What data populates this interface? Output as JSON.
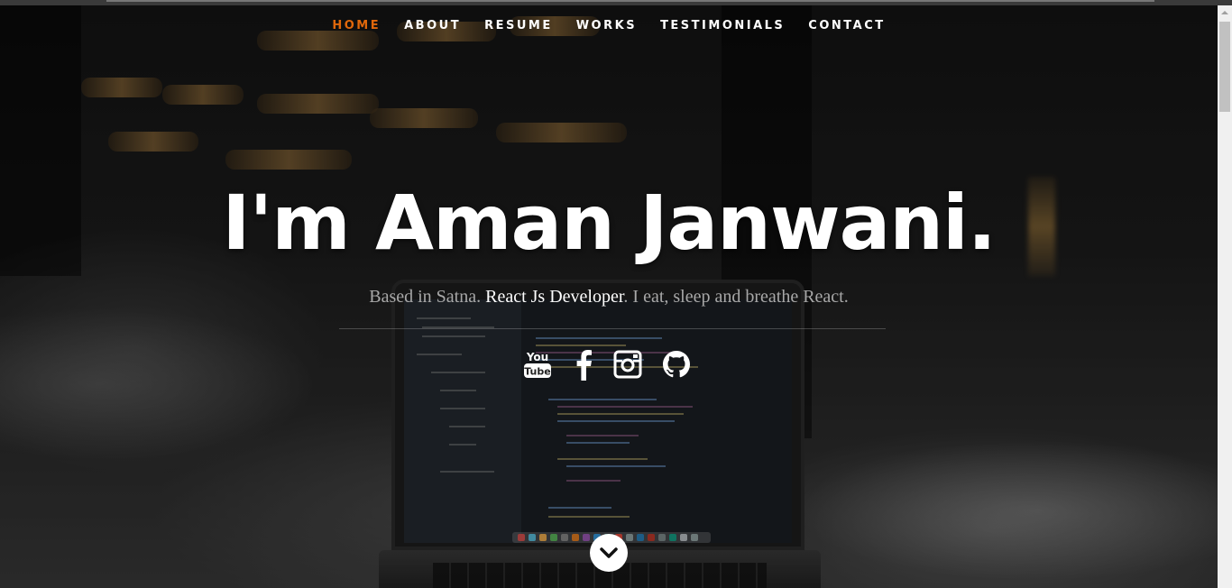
{
  "nav": {
    "items": [
      {
        "label": "HOME",
        "active": true
      },
      {
        "label": "ABOUT",
        "active": false
      },
      {
        "label": "RESUME",
        "active": false
      },
      {
        "label": "WORKS",
        "active": false
      },
      {
        "label": "TESTIMONIALS",
        "active": false
      },
      {
        "label": "CONTACT",
        "active": false
      }
    ],
    "active_color": "#e0670b"
  },
  "hero": {
    "headline": "I'm Aman Janwani.",
    "tagline_prefix": "Based in Satna. ",
    "tagline_strong": "React Js Developer",
    "tagline_suffix": ". I eat, sleep and breathe React."
  },
  "social": [
    {
      "name": "youtube-icon",
      "glyph": "You Tube"
    },
    {
      "name": "facebook-icon",
      "glyph": "f"
    },
    {
      "name": "instagram-icon",
      "glyph": ""
    },
    {
      "name": "github-icon",
      "glyph": ""
    }
  ],
  "scroll_down": {
    "icon": "chevron-down-icon"
  }
}
